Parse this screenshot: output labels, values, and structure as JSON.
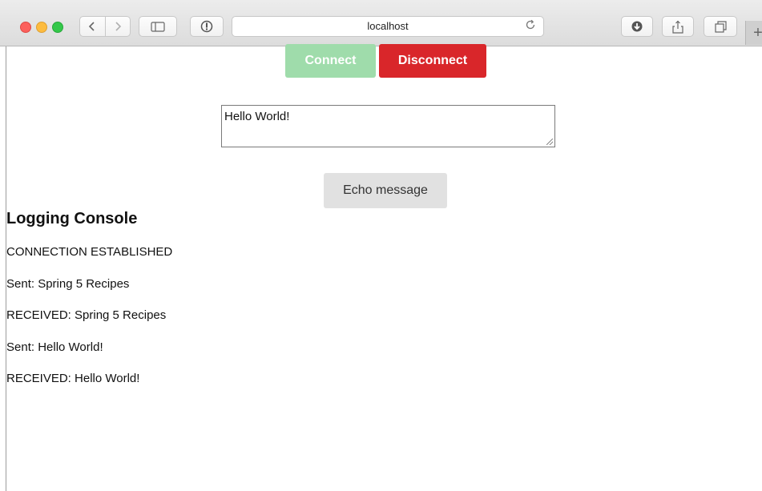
{
  "browser": {
    "address": "localhost",
    "icons": {
      "back": "chevron-left-icon",
      "forward": "chevron-right-icon",
      "sidebar": "sidebar-icon",
      "privacy": "privacy-icon",
      "reload": "reload-icon",
      "download": "download-icon",
      "share": "share-icon",
      "tabs": "tabs-icon",
      "new_tab": "plus-icon"
    }
  },
  "page": {
    "connect_label": "Connect",
    "disconnect_label": "Disconnect",
    "message_value": "Hello World!",
    "echo_label": "Echo message",
    "console_title": "Logging Console",
    "log": [
      "CONNECTION ESTABLISHED",
      "Sent: Spring 5 Recipes",
      "RECEIVED: Spring 5 Recipes",
      "Sent: Hello World!",
      "RECEIVED: Hello World!"
    ],
    "colors": {
      "connect": "#9fdcab",
      "disconnect": "#d9262a",
      "echo": "#e1e1e1"
    }
  }
}
